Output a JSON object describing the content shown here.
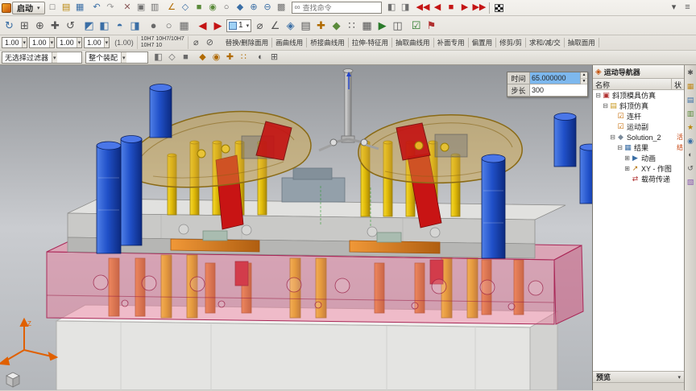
{
  "accent_colors": {
    "ribbon_bg": "#dcd9d2",
    "highlight_blue": "#7db8ee",
    "mold_pink": "#e9709a",
    "pin_yellow": "#e8c400",
    "post_blue": "#2050c8",
    "lifter_red": "#c81414"
  },
  "ribbon": {
    "start_label": "启动",
    "search_placeholder": "查找命令",
    "row1_icons": [
      {
        "n": "file-new",
        "g": "□",
        "c": "#5a5a5a"
      },
      {
        "n": "file-open",
        "g": "▤",
        "c": "#b8860b"
      },
      {
        "n": "file-save",
        "g": "▦",
        "c": "#3a6ea5"
      },
      {
        "sep": true
      },
      {
        "n": "undo",
        "g": "↶",
        "c": "#3a6ea5"
      },
      {
        "n": "redo",
        "g": "↷",
        "c": "#9a9a9a"
      },
      {
        "sep": true
      },
      {
        "n": "cut",
        "g": "✕",
        "c": "#8a5a5a"
      },
      {
        "n": "copy",
        "g": "▣",
        "c": "#707070"
      },
      {
        "n": "paste",
        "g": "▥",
        "c": "#707070"
      },
      {
        "sep": true
      },
      {
        "n": "sketch",
        "g": "∠",
        "c": "#b06a00"
      },
      {
        "n": "datum-plane",
        "g": "◇",
        "c": "#3a6ea5"
      },
      {
        "n": "extrude",
        "g": "■",
        "c": "#5a8a3a"
      },
      {
        "n": "revolve",
        "g": "◉",
        "c": "#5a8a3a"
      },
      {
        "n": "hole",
        "g": "○",
        "c": "#555555"
      },
      {
        "n": "edge-blend",
        "g": "◆",
        "c": "#3a6ea5"
      },
      {
        "n": "unite",
        "g": "⊕",
        "c": "#3a6ea5"
      },
      {
        "n": "subtract",
        "g": "⊖",
        "c": "#3a6ea5"
      },
      {
        "n": "pattern",
        "g": "▩",
        "c": "#707070"
      }
    ],
    "row1_right_icons": [
      {
        "n": "window-cascade",
        "g": "◧",
        "c": "#707070"
      },
      {
        "n": "window-tile",
        "g": "◨",
        "c": "#707070"
      },
      {
        "sep": true
      },
      {
        "n": "rewind",
        "g": "◀◀",
        "c": "#c41414"
      },
      {
        "n": "step-back",
        "g": "◀",
        "c": "#c41414"
      },
      {
        "n": "stop",
        "g": "■",
        "c": "#c41414"
      },
      {
        "n": "play",
        "g": "▶",
        "c": "#c41414"
      },
      {
        "n": "fast-forward",
        "g": "▶▶",
        "c": "#c41414"
      }
    ],
    "row1_end_icons": [
      {
        "n": "animation-options",
        "g": "▾",
        "c": "#555555"
      },
      {
        "n": "minimize-ribbon",
        "g": "≡",
        "c": "#555555"
      }
    ],
    "row2_icons_a": [
      {
        "n": "refresh",
        "g": "↻",
        "c": "#3a6ea5"
      },
      {
        "n": "fit-view",
        "g": "⊞",
        "c": "#555555"
      },
      {
        "n": "zoom",
        "g": "⊕",
        "c": "#555555"
      },
      {
        "n": "pan",
        "g": "✚",
        "c": "#555555"
      },
      {
        "n": "rotate-view",
        "g": "↺",
        "c": "#555555"
      },
      {
        "sep": true
      },
      {
        "n": "trimetric-view",
        "g": "◩",
        "c": "#3a6ea5"
      },
      {
        "n": "front-view",
        "g": "◧",
        "c": "#3a6ea5"
      },
      {
        "n": "top-view",
        "g": "◓",
        "c": "#3a6ea5"
      },
      {
        "n": "right-view",
        "g": "◨",
        "c": "#3a6ea5"
      },
      {
        "sep": true
      },
      {
        "n": "shaded-mode",
        "g": "●",
        "c": "#6a6a6a"
      },
      {
        "n": "wireframe-mode",
        "g": "○",
        "c": "#6a6a6a"
      },
      {
        "n": "edges-display",
        "g": "▦",
        "c": "#6a6a6a"
      },
      {
        "sep": true
      },
      {
        "n": "play-previous",
        "g": "◀",
        "c": "#c41414"
      },
      {
        "n": "play-next",
        "g": "▶",
        "c": "#c41414"
      }
    ],
    "row2_swatch_value": "1",
    "row2_icons_b": [
      {
        "n": "measure-diameter",
        "g": "⌀",
        "c": "#555555"
      },
      {
        "n": "measure-angle",
        "g": "∠",
        "c": "#555555"
      },
      {
        "n": "object-info",
        "g": "◈",
        "c": "#3a6ea5"
      },
      {
        "n": "layer-settings",
        "g": "▤",
        "c": "#555555"
      },
      {
        "n": "wcs-orient",
        "g": "✚",
        "c": "#b06a00"
      },
      {
        "n": "constraints",
        "g": "◆",
        "c": "#5a8a3a"
      },
      {
        "n": "snap-point",
        "g": "∷",
        "c": "#555555"
      },
      {
        "n": "grid-toggle",
        "g": "▦",
        "c": "#555555"
      },
      {
        "n": "macro-play",
        "g": "▶",
        "c": "#2a7a2a"
      },
      {
        "n": "split-window",
        "g": "◫",
        "c": "#555555"
      },
      {
        "sep": true
      },
      {
        "n": "check-mate",
        "g": "☑",
        "c": "#2a7a2a"
      },
      {
        "n": "flag-note",
        "g": "⚑",
        "c": "#b03030"
      }
    ],
    "row3_values": [
      "1.00",
      "1.00",
      "1.00",
      "1.00"
    ],
    "row3_paren_value": "(1.00)",
    "row3_tol_line1": "10H7  10H7/10H7",
    "row3_tol_line2": "10H7  10",
    "row3_icons": [
      {
        "n": "diameter-preset",
        "g": "⌀",
        "c": "#555555"
      },
      {
        "n": "tolerance-preset",
        "g": "⊘",
        "c": "#555555"
      }
    ],
    "group_tabs": [
      "替换/删除面用",
      "画曲线用",
      "桥接曲线用",
      "拉伸-特征用",
      "抽取曲线用",
      "补面专用",
      "偏置用",
      "修剪/剪",
      "求和/减/交",
      "抽取面用"
    ]
  },
  "selection_bar": {
    "filter_value": "无选择过滤器",
    "scope_value": "整个装配",
    "icons": [
      {
        "n": "select-face",
        "g": "◧",
        "c": "#6a6a6a"
      },
      {
        "n": "select-edge",
        "g": "◇",
        "c": "#6a6a6a"
      },
      {
        "n": "select-body",
        "g": "■",
        "c": "#6a6a6a"
      },
      {
        "sep": true
      },
      {
        "n": "snap-midpoint",
        "g": "◆",
        "c": "#b06a00"
      },
      {
        "n": "snap-center",
        "g": "◉",
        "c": "#b06a00"
      },
      {
        "n": "snap-intersection",
        "g": "✚",
        "c": "#b06a00"
      },
      {
        "n": "snap-endpoint",
        "g": "∷",
        "c": "#b06a00"
      },
      {
        "sep": true
      },
      {
        "n": "show-hide",
        "g": "◐",
        "c": "#555555"
      },
      {
        "n": "wcs-toggle",
        "g": "⊞",
        "c": "#555555"
      }
    ]
  },
  "viewport": {
    "time_label": "时间",
    "time_value": "65.000000",
    "step_label": "步长",
    "step_value": "300",
    "triad_z_label": "Z"
  },
  "navigator": {
    "title": "运动导航器",
    "columns": {
      "name": "名称",
      "status": "状"
    },
    "tree": [
      {
        "id": "sim-root",
        "label": "斜顶模具仿真",
        "depth": 0,
        "exp": "-",
        "icon": "▣",
        "color": "#b03030",
        "status": ""
      },
      {
        "id": "sim-folder",
        "label": "斜顶仿真",
        "depth": 1,
        "exp": "-",
        "icon": "▤",
        "color": "#c89a20",
        "status": ""
      },
      {
        "id": "links",
        "label": "连杆",
        "depth": 2,
        "exp": "",
        "icon": "☑",
        "color": "#c46a00",
        "status": ""
      },
      {
        "id": "joints",
        "label": "运动副",
        "depth": 2,
        "exp": "",
        "icon": "☑",
        "color": "#c46a00",
        "status": ""
      },
      {
        "id": "solution",
        "label": "Solution_2",
        "depth": 2,
        "exp": "-",
        "icon": "◆",
        "color": "#7a8a9a",
        "status": "活"
      },
      {
        "id": "results",
        "label": "结果",
        "depth": 3,
        "exp": "-",
        "icon": "▦",
        "color": "#3a6ea5",
        "status": "结"
      },
      {
        "id": "animation",
        "label": "动画",
        "depth": 4,
        "exp": "+",
        "icon": "▶",
        "color": "#3a6ea5",
        "status": ""
      },
      {
        "id": "xy-graph",
        "label": "XY - 作图",
        "depth": 4,
        "exp": "+",
        "icon": "↗",
        "color": "#b06a00",
        "status": ""
      },
      {
        "id": "load-transfer",
        "label": "载荷传递",
        "depth": 4,
        "exp": "",
        "icon": "⇄",
        "color": "#b03030",
        "status": ""
      }
    ],
    "preview_label": "预览"
  },
  "resource_strip": {
    "icons": [
      {
        "n": "roles-gear",
        "g": "✱",
        "c": "#555555"
      },
      {
        "n": "assembly-navigator",
        "g": "▦",
        "c": "#c08a20"
      },
      {
        "n": "constraint-navigator",
        "g": "▤",
        "c": "#3a6ea5"
      },
      {
        "n": "part-navigator",
        "g": "▥",
        "c": "#5a8a3a"
      },
      {
        "n": "reuse-library",
        "g": "★",
        "c": "#b8860b"
      },
      {
        "n": "hd3d-tools",
        "g": "◉",
        "c": "#3a6ea5"
      },
      {
        "n": "web-browser",
        "g": "◐",
        "c": "#555555"
      },
      {
        "n": "history",
        "g": "↺",
        "c": "#555555"
      },
      {
        "n": "system-palette",
        "g": "▧",
        "c": "#8a5ab0"
      }
    ]
  }
}
